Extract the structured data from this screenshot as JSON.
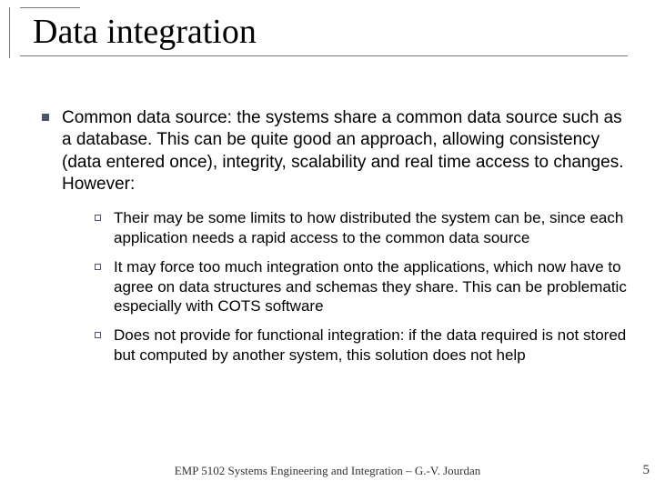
{
  "slide": {
    "title": "Data integration",
    "main": {
      "text": "Common data source: the systems share a common data source such as a database. This can be quite good an approach, allowing consistency (data entered once), integrity, scalability and real time access to changes. However:",
      "subs": [
        "Their may be some limits to how distributed the system can be, since each application needs a rapid access to the common data source",
        "It may force too much integration onto the applications, which now have to agree on data structures and schemas they share. This can be problematic especially with COTS software",
        "Does not provide for functional integration: if the data required is not stored but computed by another system, this solution does not help"
      ]
    },
    "footer": "EMP 5102 Systems Engineering and Integration – G.-V. Jourdan",
    "page": "5"
  }
}
